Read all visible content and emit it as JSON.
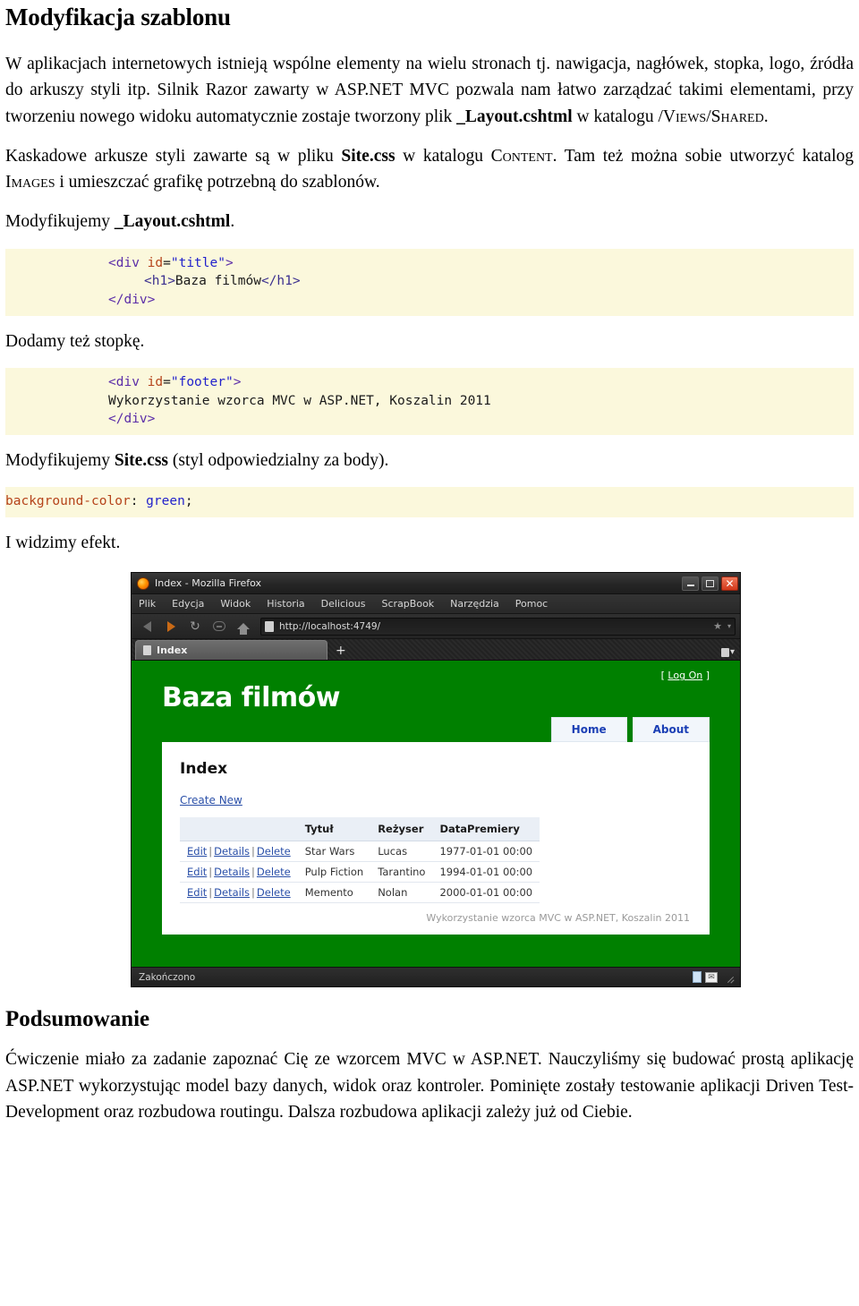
{
  "doc": {
    "heading": "Modyfikacja szablonu",
    "para1_a": "W aplikacjach internetowych istnieją wspólne elementy na wielu stronach tj. nawigacja, nagłówek, stopka, logo, źródła do arkuszy styli itp. Silnik Razor zawarty w ASP.NET MVC pozwala nam łatwo zarządzać takimi elementami, przy tworzeniu nowego widoku automatycznie zostaje tworzony plik ",
    "para1_file": "_Layout.cshtml",
    "para1_b": " w katalogu /",
    "para1_sc1": "Views",
    "para1_c": "/",
    "para1_sc2": "Shared",
    "para1_d": ".",
    "para2_a": "Kaskadowe arkusze styli zawarte są w pliku ",
    "para2_file": "Site.css",
    "para2_b": " w katalogu ",
    "para2_sc1": "Content",
    "para2_c": ". Tam też można sobie utworzyć katalog ",
    "para2_sc2": "Images",
    "para2_d": " i umieszczać grafikę potrzebną do szablonów.",
    "para3_a": "Modyfikujemy ",
    "para3_file": "_Layout.cshtml",
    "para3_b": ".",
    "para4": "Dodamy też stopkę.",
    "para5_a": "Modyfikujemy ",
    "para5_file": "Site.css",
    "para5_b": " (styl odpowiedzialny za body).",
    "para6": "I widzimy efekt.",
    "summary_heading": "Podsumowanie",
    "summary_text": "Ćwiczenie miało za zadanie zapoznać Cię ze wzorcem MVC w ASP.NET. Nauczyliśmy się budować prostą aplikację ASP.NET wykorzystując model bazy danych, widok oraz kontroler. Pominięte zostały testowanie aplikacji Driven Test-Development oraz rozbudowa routingu. Dalsza rozbudowa aplikacji zależy już od Ciebie."
  },
  "code_title": {
    "l1_open": "<div ",
    "l1_attr": "id",
    "l1_eq": "=",
    "l1_val": "\"title\"",
    "l1_close": ">",
    "l2_open": "<h1>",
    "l2_text": "Baza filmów",
    "l2_close": "</h1>",
    "l3": "</div>"
  },
  "code_footer": {
    "l1_open": "<div ",
    "l1_attr": "id",
    "l1_eq": "=",
    "l1_val": "\"footer\"",
    "l1_close": ">",
    "l2_text": "Wykorzystanie wzorca MVC w ASP.NET, Koszalin 2011",
    "l3": "</div>"
  },
  "code_css": {
    "prop": "background-color",
    "colon": ": ",
    "value": "green",
    "semi": ";"
  },
  "browser": {
    "window_title": "Index - Mozilla Firefox",
    "minimize_label": "−",
    "maximize_label": "□",
    "close_label": "✕",
    "menu": [
      "Plik",
      "Edycja",
      "Widok",
      "Historia",
      "Delicious",
      "ScrapBook",
      "Narzędzia",
      "Pomoc"
    ],
    "url": "http://localhost:4749/",
    "star_glyph": "★",
    "caret_glyph": "▾",
    "reload_glyph": "↻",
    "tab_label": "Index",
    "newtab_glyph": "+",
    "status": "Zakończono",
    "status_mail_glyph": "✉"
  },
  "webpage": {
    "logon_open": "[ ",
    "logon_label": "Log On",
    "logon_close": " ]",
    "site_title": "Baza filmów",
    "nav": [
      "Home",
      "About"
    ],
    "index_heading": "Index",
    "create_new": "Create New",
    "table": {
      "headers": [
        "",
        "Tytuł",
        "Reżyser",
        "DataPremiery"
      ],
      "action_labels": [
        "Edit",
        "Details",
        "Delete"
      ],
      "separator": "|",
      "rows": [
        {
          "title": "Star Wars",
          "director": "Lucas",
          "premiere": "1977-01-01 00:00"
        },
        {
          "title": "Pulp Fiction",
          "director": "Tarantino",
          "premiere": "1994-01-01 00:00"
        },
        {
          "title": "Memento",
          "director": "Nolan",
          "premiere": "2000-01-01 00:00"
        }
      ]
    },
    "footer": "Wykorzystanie wzorca MVC w ASP.NET, Koszalin 2011"
  },
  "colors": {
    "page_green": "#008000",
    "code_bg": "#fbf8dc",
    "link_blue": "#2a4fa8",
    "close_red": "#d1371a"
  }
}
